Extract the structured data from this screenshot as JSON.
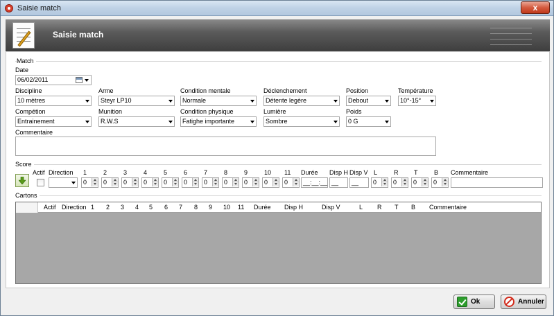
{
  "window": {
    "title": "Saisie match",
    "close_label": "x"
  },
  "banner": {
    "title": "Saisie match"
  },
  "match": {
    "group_label": "Match",
    "date_label": "Date",
    "date_value": "06/02/2011",
    "discipline_label": "Discipline",
    "discipline_value": "10 mètres",
    "arme_label": "Arme",
    "arme_value": "Steyr LP10",
    "cond_mentale_label": "Condition mentale",
    "cond_mentale_value": "Normale",
    "declenchement_label": "Déclenchement",
    "declenchement_value": "Détente legère",
    "position_label": "Position",
    "position_value": "Debout",
    "temperature_label": "Température",
    "temperature_value": "10°-15°",
    "competition_label": "Compétion",
    "competition_value": "Entrainement",
    "munition_label": "Munition",
    "munition_value": "R.W.S",
    "cond_physique_label": "Condition physique",
    "cond_physique_value": "Fatighe importante",
    "lumiere_label": "Lumière",
    "lumiere_value": "Sombre",
    "poids_label": "Poids",
    "poids_value": "0 G",
    "commentaire_label": "Commentaire"
  },
  "score": {
    "group_label": "Score",
    "actif_label": "Actif",
    "direction_label": "Direction",
    "shot_labels": [
      "1",
      "2",
      "3",
      "4",
      "5",
      "6",
      "7",
      "8",
      "9",
      "10",
      "11"
    ],
    "shot_values": [
      "0",
      "0",
      "0",
      "0",
      "0",
      "0",
      "0",
      "0",
      "0",
      "0",
      "0"
    ],
    "duree_label": "Durée",
    "duree_value": "__:__:__",
    "disp_h_label": "Disp H",
    "disp_h_value": "__",
    "disp_v_label": "Disp V",
    "disp_v_value": "__",
    "l_label": "L",
    "l_value": "0",
    "r_label": "R",
    "r_value": "0",
    "t_label": "T",
    "t_value": "0",
    "b_label": "B",
    "b_value": "0",
    "commentaire_label": "Commentaire"
  },
  "cartons": {
    "group_label": "Cartons",
    "columns": [
      "Actif",
      "Direction",
      "1",
      "2",
      "3",
      "4",
      "5",
      "6",
      "7",
      "8",
      "9",
      "10",
      "11",
      "Durée",
      "Disp H",
      "Disp V",
      "L",
      "R",
      "T",
      "B",
      "Commentaire"
    ]
  },
  "footer": {
    "ok_label": "Ok",
    "cancel_label": "Annuler"
  },
  "colors": {
    "ok": "#2d9e2d",
    "cancel": "#d22a1a",
    "add": "#5a9a1a"
  }
}
